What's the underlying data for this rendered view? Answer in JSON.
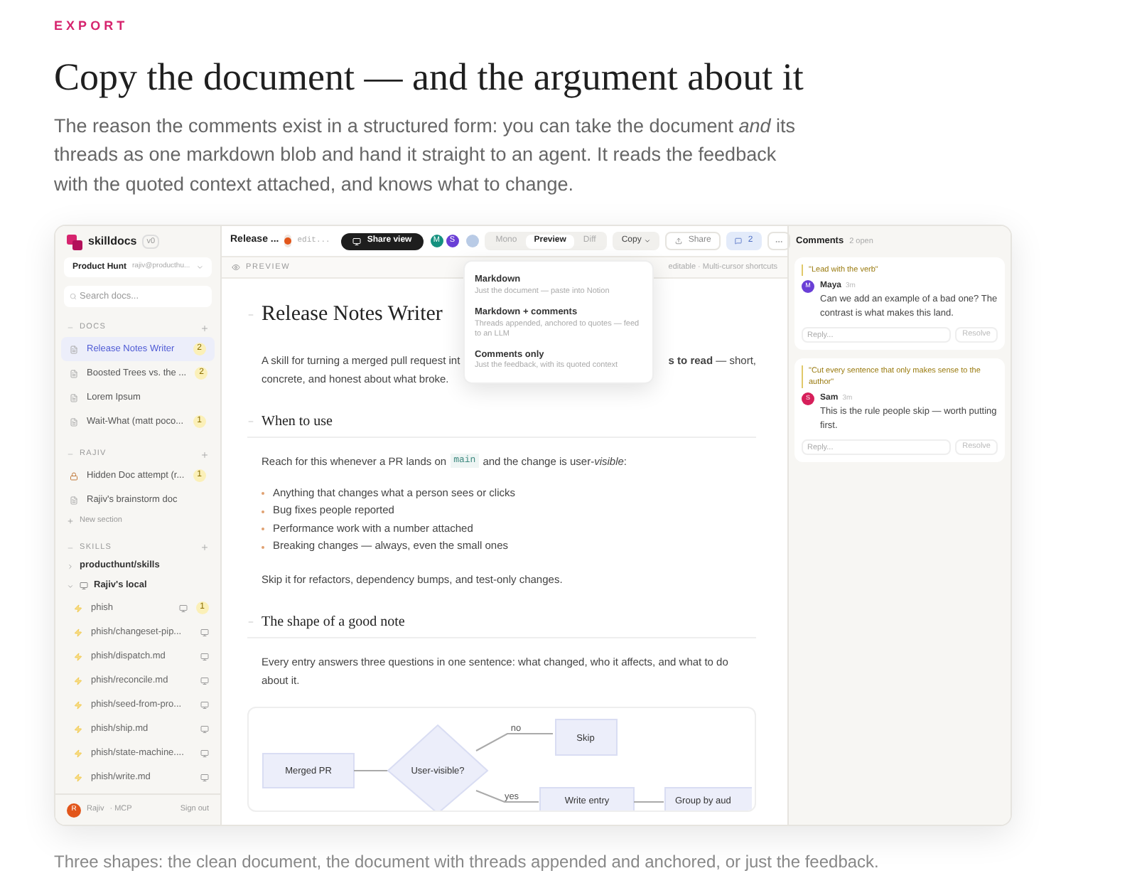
{
  "eyebrow": "EXPORT",
  "title": "Copy the document — and the argument about it",
  "intro": "The reason the comments exist in a structured form: you can take the document *and* its threads as one markdown blob and hand it straight to an agent. It reads the feedback with the quoted context attached, and knows what to change.",
  "app": {
    "sidebar": {
      "brand": "skilldocs",
      "version": "v0",
      "workspace": "Product Hunt",
      "account": "rajiv@producthu...",
      "search_placeholder": "Search docs...",
      "sections": [
        {
          "title": "DOCS",
          "items": [
            {
              "label": "Release Notes Writer",
              "kind": "doc",
              "selected": true,
              "count": "2"
            },
            {
              "label": "Boosted Trees vs. the ...",
              "kind": "doc",
              "selected": false,
              "count": "2"
            },
            {
              "label": "Lorem Ipsum",
              "kind": "doc",
              "selected": false
            },
            {
              "label": "Wait-What (matt poco...",
              "kind": "doc",
              "selected": false,
              "count": "1"
            }
          ]
        },
        {
          "title": "RAJIV",
          "items": [
            {
              "label": "Hidden Doc attempt (r...",
              "kind": "hidden",
              "selected": false,
              "count": "1"
            },
            {
              "label": "Rajiv's brainstorm doc",
              "kind": "doc",
              "selected": false
            }
          ],
          "link": "New section"
        }
      ],
      "skills": {
        "title": "SKILLS",
        "tree": [
          {
            "label": "producthunt/skills",
            "expanded": false
          },
          {
            "label": "Rajiv's local",
            "expanded": true,
            "children": [
              {
                "label": "phish",
                "count": "1"
              },
              {
                "label": "phish/changeset-pip..."
              },
              {
                "label": "phish/dispatch.md"
              },
              {
                "label": "phish/reconcile.md"
              },
              {
                "label": "phish/seed-from-pro..."
              },
              {
                "label": "phish/ship.md"
              },
              {
                "label": "phish/state-machine...."
              },
              {
                "label": "phish/write.md"
              }
            ]
          }
        ]
      },
      "footer": {
        "initial": "R",
        "user": "Rajiv",
        "mode": "· MCP",
        "sign_out": "Sign out"
      }
    },
    "toolbar": {
      "doc_title": "Release ...",
      "status": "edit...",
      "share_view": "Share view",
      "avatars": [
        {
          "initial": "M",
          "color": "#14917f"
        },
        {
          "initial": "S",
          "color": "#6a3fd6"
        }
      ],
      "view_tabs": [
        {
          "label": "Mono",
          "selected": false
        },
        {
          "label": "Preview",
          "selected": true
        },
        {
          "label": "Diff",
          "selected": false
        }
      ],
      "copy": "Copy",
      "share": "Share",
      "comments_count": "2"
    },
    "copy_menu": [
      {
        "label": "Markdown",
        "hint": "Just the document — paste into Notion"
      },
      {
        "label": "Markdown + comments",
        "hint": "Threads appended, anchored to quotes — feed to an LLM"
      },
      {
        "label": "Comments only",
        "hint": "Just the feedback, with its quoted context"
      }
    ],
    "preview_bar": {
      "label": "PREVIEW",
      "meta": "editable · Multi-cursor shortcuts"
    },
    "document": {
      "title": "Release Notes Writer",
      "intro_lines": [
        "A skill for turning a merged pull request int",
        "**s to read** — short,",
        "concrete, and honest about what broke."
      ],
      "blocks": [
        {
          "kind": "heading",
          "text": "When to use"
        },
        {
          "kind": "code_paragraph",
          "before": "Reach for this whenever a PR lands on",
          "code": "main",
          "after": "and the change is user-*visible*:"
        },
        {
          "kind": "list",
          "items": [
            "Anything that changes what a person sees or clicks",
            "Bug fixes people reported",
            "Performance work with a number attached",
            "Breaking changes — always, even the small ones"
          ]
        },
        {
          "kind": "paragraph",
          "text": "Skip it for refactors, dependency bumps, and test-only changes."
        },
        {
          "kind": "heading",
          "text": "The shape of a good note"
        },
        {
          "kind": "paragraph",
          "text": "Every entry answers three questions in one sentence: what changed, who it affects, and what to do about it."
        },
        {
          "kind": "flowchart",
          "nodes": [
            "Merged PR",
            "User-visible?",
            "Skip",
            "Write entry",
            "Group by aud"
          ],
          "edge_labels": [
            "no",
            "yes"
          ]
        }
      ]
    },
    "comments": {
      "title": "Comments",
      "count": "2 open",
      "threads": [
        {
          "quote": "\"Lead with the verb\"",
          "author": "Maya",
          "initial": "M",
          "color": "#6a3fd6",
          "time": "3m",
          "text": "Can we add an example of a bad one? The contrast is what makes this land.",
          "reply_placeholder": "Reply...",
          "resolve": "Resolve"
        },
        {
          "quote": "\"Cut every sentence that only makes sense to the author\"",
          "author": "Sam",
          "initial": "S",
          "color": "#d61f5a",
          "time": "3m",
          "text": "This is the rule people skip — worth putting first.",
          "reply_placeholder": "Reply...",
          "resolve": "Resolve"
        }
      ]
    }
  },
  "caption": "Three shapes: the clean document, the document with threads appended and anchored, or just the feedback."
}
